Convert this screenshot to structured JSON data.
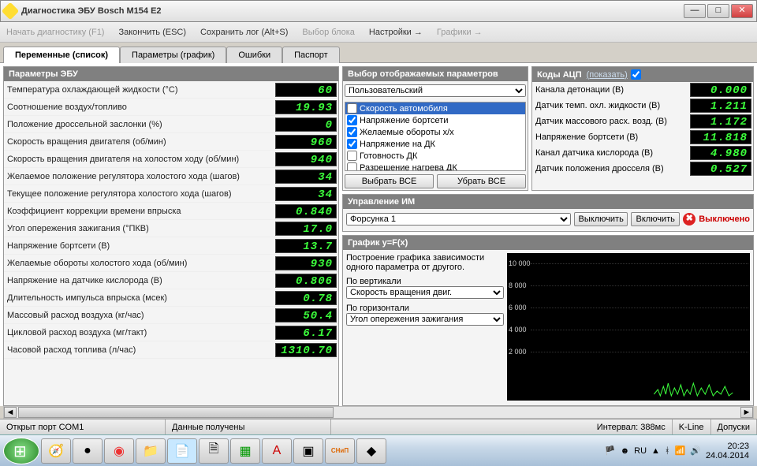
{
  "window": {
    "title": "Диагностика ЭБУ Bosch M154 E2"
  },
  "menu": {
    "start": "Начать диагностику (F1)",
    "end": "Закончить (ESC)",
    "save": "Сохранить лог (Alt+S)",
    "block": "Выбор блока",
    "settings": "Настройки →",
    "graphs": "Графики →"
  },
  "tabs": {
    "vars": "Переменные (список)",
    "params": "Параметры (график)",
    "errors": "Ошибки",
    "passport": "Паспорт"
  },
  "ecu": {
    "header": "Параметры ЭБУ",
    "rows": [
      {
        "label": "Температура охлаждающей жидкости (°С)",
        "value": "60"
      },
      {
        "label": "Соотношение воздух/топливо",
        "value": "19.93"
      },
      {
        "label": "Положение дроссельной заслонки (%)",
        "value": "0"
      },
      {
        "label": "Скорость вращения двигателя (об/мин)",
        "value": "960"
      },
      {
        "label": "Скорость вращения двигателя на холостом ходу (об/мин)",
        "value": "940"
      },
      {
        "label": "Желаемое положение регулятора холостого хода (шагов)",
        "value": "34"
      },
      {
        "label": "Текущее положение регулятора холостого хода (шагов)",
        "value": "34"
      },
      {
        "label": "Коэффициент коррекции времени впрыска",
        "value": "0.840"
      },
      {
        "label": "Угол опережения зажигания (°ПКВ)",
        "value": "17.0"
      },
      {
        "label": "Напряжение бортсети (В)",
        "value": "13.7"
      },
      {
        "label": "Желаемые обороты холостого хода (об/мин)",
        "value": "930"
      },
      {
        "label": "Напряжение на датчике кислорода (В)",
        "value": "0.806"
      },
      {
        "label": "Длительность импульса впрыска (мсек)",
        "value": "0.78"
      },
      {
        "label": "Массовый расход воздуха (кг/час)",
        "value": "50.4"
      },
      {
        "label": "Цикловой расход воздуха (мг/такт)",
        "value": "6.17"
      },
      {
        "label": "Часовой расход топлива (л/час)",
        "value": "1310.70"
      }
    ]
  },
  "sel": {
    "header": "Выбор отображаемых параметров",
    "mode": "Пользовательский",
    "items": [
      {
        "label": "Скорость автомобиля",
        "checked": false,
        "sel": true
      },
      {
        "label": "Напряжение бортсети",
        "checked": true
      },
      {
        "label": "Желаемые обороты х/х",
        "checked": true
      },
      {
        "label": "Напряжение на ДК",
        "checked": true
      },
      {
        "label": "Готовность ДК",
        "checked": false
      },
      {
        "label": "Разрешение нагрева ДК",
        "checked": false
      }
    ],
    "btn_all": "Выбрать ВСЕ",
    "btn_none": "Убрать ВСЕ"
  },
  "adc": {
    "header": "Коды АЦП",
    "show": "(показать)",
    "rows": [
      {
        "label": "Канала детонации (В)",
        "value": "0.000"
      },
      {
        "label": "Датчик темп. охл. жидкости (В)",
        "value": "1.211"
      },
      {
        "label": "Датчик массового расх. возд. (В)",
        "value": "1.172"
      },
      {
        "label": "Напряжение бортсети (В)",
        "value": "11.818"
      },
      {
        "label": "Канал датчика кислорода (В)",
        "value": "4.980"
      },
      {
        "label": "Датчик положения дросселя (В)",
        "value": "0.527"
      }
    ]
  },
  "im": {
    "header": "Управление ИМ",
    "dev": "Форсунка 1",
    "off": "Выключить",
    "on": "Включить",
    "status": "Выключено"
  },
  "graph": {
    "header": "График y=F(x)",
    "desc": "Построение графика зависимости одного параметра от другого.",
    "vlabel": "По вертикали",
    "vsel": "Скорость вращения двиг.",
    "hlabel": "По горизонтали",
    "hsel": "Угол опережения зажигания",
    "ticks": [
      "10 000",
      "8 000",
      "6 000",
      "4 000",
      "2 000"
    ]
  },
  "status": {
    "port": "Открыт порт COM1",
    "data": "Данные получены",
    "interval_lbl": "Интервал:",
    "interval_val": "388мс",
    "kline": "K-Line",
    "dopuski": "Допуски"
  },
  "tray": {
    "lang": "RU",
    "time": "20:23",
    "date": "24.04.2014"
  }
}
